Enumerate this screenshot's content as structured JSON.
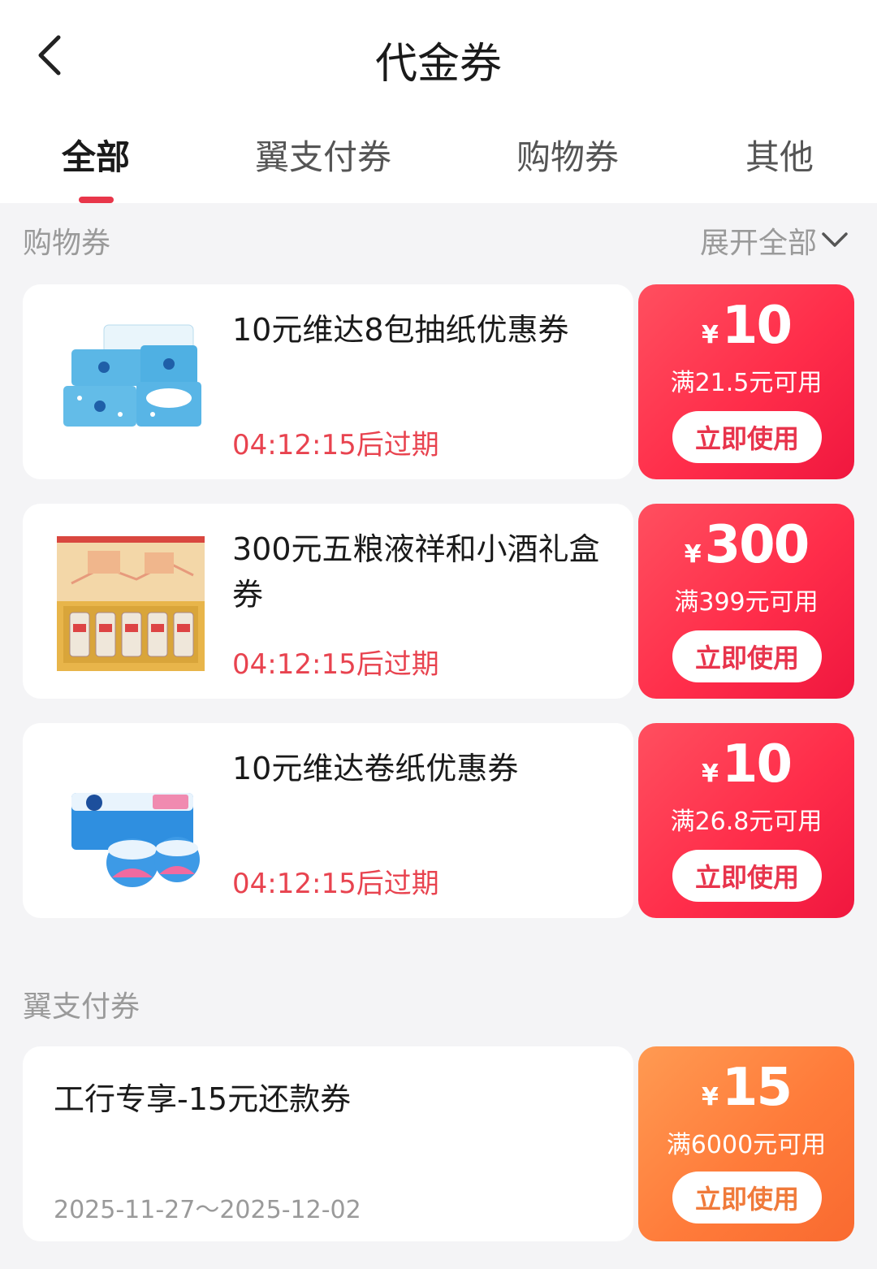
{
  "header": {
    "title": "代金券",
    "back_icon": "chevron-left-icon"
  },
  "tabs": [
    {
      "label": "全部",
      "active": true
    },
    {
      "label": "翼支付券",
      "active": false
    },
    {
      "label": "购物券",
      "active": false
    },
    {
      "label": "其他",
      "active": false
    }
  ],
  "shopping_section": {
    "title": "购物券",
    "expand_label": "展开全部",
    "coupons": [
      {
        "name": "10元维达8包抽纸优惠券",
        "expire": "04:12:15后过期",
        "currency": "¥",
        "amount": "10",
        "condition": "满21.5元可用",
        "button": "立即使用"
      },
      {
        "name": "300元五粮液祥和小酒礼盒券",
        "expire": "04:12:15后过期",
        "currency": "¥",
        "amount": "300",
        "condition": "满399元可用",
        "button": "立即使用"
      },
      {
        "name": "10元维达卷纸优惠券",
        "expire": "04:12:15后过期",
        "currency": "¥",
        "amount": "10",
        "condition": "满26.8元可用",
        "button": "立即使用"
      }
    ]
  },
  "pay_section": {
    "title": "翼支付券",
    "coupons": [
      {
        "name": "工行专享-15元还款券",
        "date_range": "2025-11-27～2025-12-02",
        "currency": "¥",
        "amount": "15",
        "condition": "满6000元可用",
        "button": "立即使用"
      }
    ]
  },
  "colors": {
    "accent_red": "#e8364a",
    "coupon_red": "#ff2d4a",
    "coupon_orange": "#ff7b3a",
    "expire_text": "#e8434f"
  }
}
